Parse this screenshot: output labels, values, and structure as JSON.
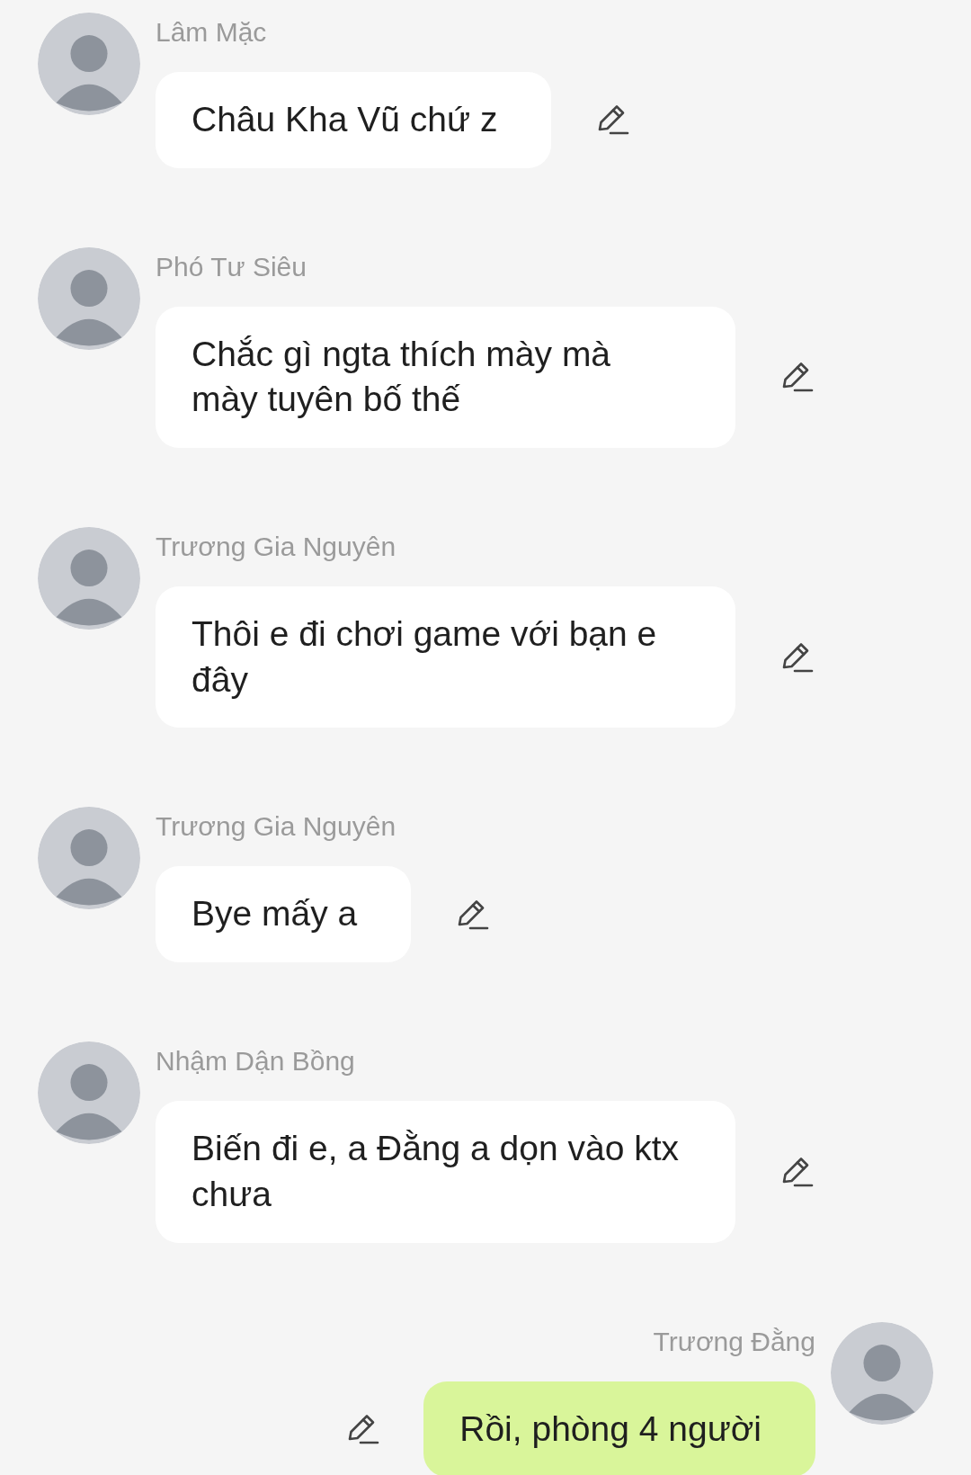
{
  "messages": [
    {
      "sender": "Lâm Mặc",
      "text": "Châu Kha Vũ chứ z",
      "outgoing": false
    },
    {
      "sender": "Phó Tư Siêu",
      "text": "Chắc gì ngta thích mày mà mày tuyên bố thế",
      "outgoing": false
    },
    {
      "sender": "Trương Gia Nguyên",
      "text": "Thôi e đi chơi game với bạn e đây",
      "outgoing": false
    },
    {
      "sender": "Trương Gia Nguyên",
      "text": "Bye mấy a",
      "outgoing": false
    },
    {
      "sender": "Nhậm Dận Bồng",
      "text": "Biến đi e, a Đằng a dọn vào ktx chưa",
      "outgoing": false
    },
    {
      "sender": "Trương Đằng",
      "text": "Rồi, phòng 4 người",
      "outgoing": true
    }
  ]
}
